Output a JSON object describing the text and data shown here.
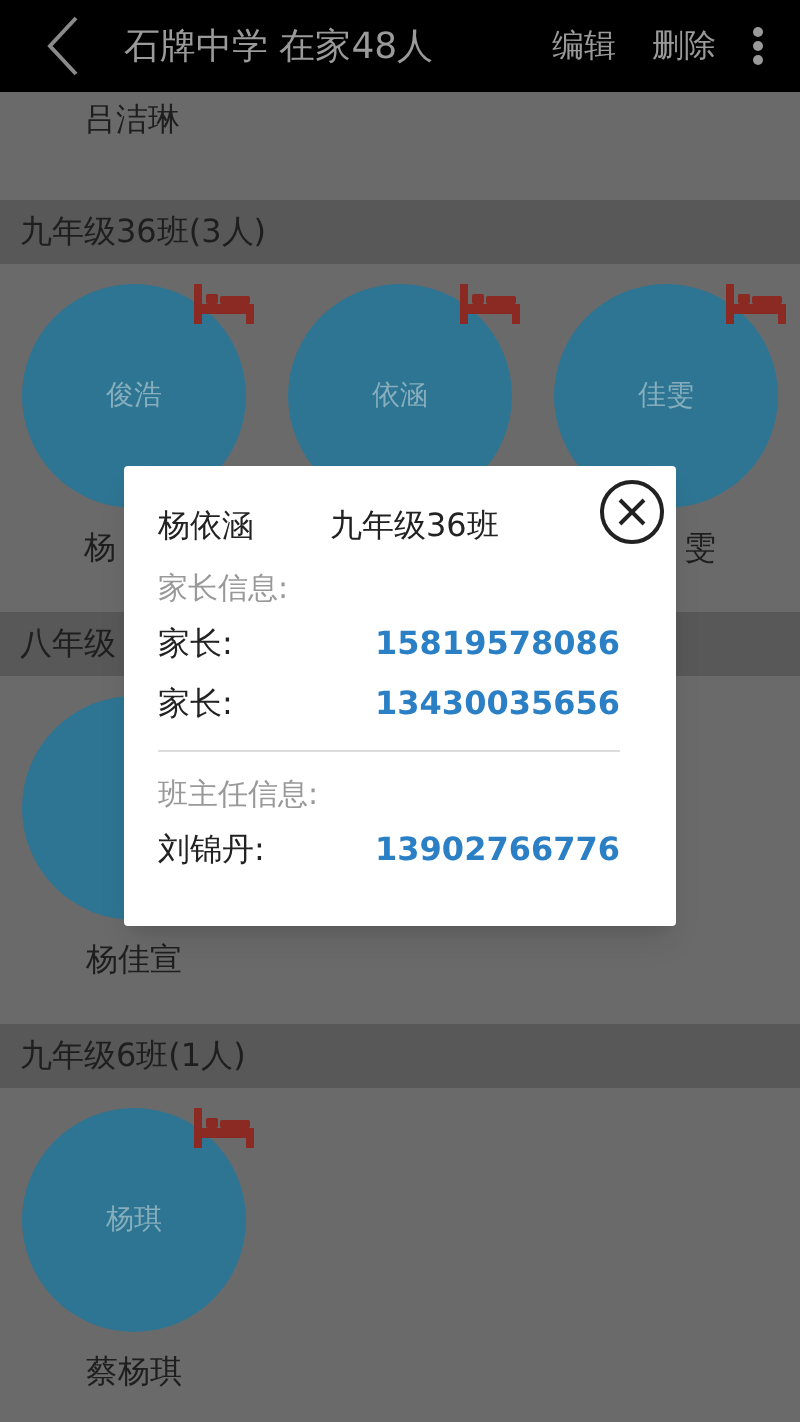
{
  "header": {
    "title": "石牌中学 在家48人",
    "actions": [
      "编辑",
      "删除"
    ]
  },
  "top_name": "吕洁琳",
  "groups": [
    {
      "title": "九年级36班(3人)",
      "students": [
        {
          "avatar_text": "俊浩",
          "at_home": true,
          "name": "杨",
          "kind": "head"
        },
        {
          "avatar_text": "依涵",
          "at_home": true
        },
        {
          "avatar_text": "佳雯",
          "at_home": true,
          "name": "雯",
          "kind": "tail"
        }
      ]
    },
    {
      "title": "八年级",
      "students": [
        {
          "name": "杨佳宣",
          "kind": "full"
        }
      ]
    },
    {
      "title": "九年级6班(1人)",
      "students": [
        {
          "avatar_text": "杨琪",
          "at_home": true,
          "name": "蔡杨琪",
          "kind": "full"
        }
      ]
    }
  ],
  "dialog": {
    "student": "杨依涵",
    "class": "九年级36班",
    "sections": [
      {
        "title": "家长信息:",
        "contacts": [
          {
            "label": "家长:",
            "phone": "15819578086"
          },
          {
            "label": "家长:",
            "phone": "13430035656"
          }
        ]
      },
      {
        "title": "班主任信息:",
        "contacts": [
          {
            "label": "刘锦丹:",
            "phone": "13902766776"
          }
        ]
      }
    ]
  }
}
